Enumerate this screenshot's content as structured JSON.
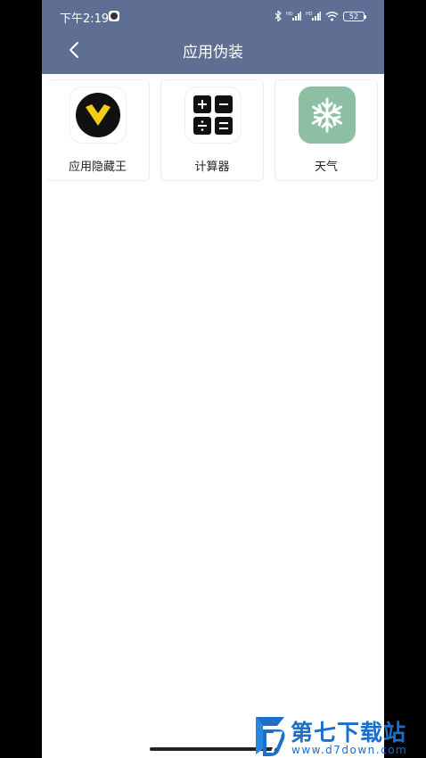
{
  "status_bar": {
    "time": "下午2:19",
    "battery_level": "52",
    "icons": [
      "notification-app-icon",
      "bluetooth-icon",
      "cellular-signal-icon",
      "cellular-signal-icon",
      "wifi-icon",
      "battery-icon"
    ]
  },
  "header": {
    "back_icon": "chevron-left-icon",
    "title": "应用伪装",
    "background_color": "#5f6e93"
  },
  "apps": [
    {
      "label": "应用隐藏王",
      "icon": "app-hider-logo-icon"
    },
    {
      "label": "计算器",
      "icon": "calculator-icon"
    },
    {
      "label": "天气",
      "icon": "snowflake-icon",
      "icon_background": "#8dbfa5"
    }
  ],
  "watermark": {
    "title": "第七下载站",
    "url": "www.d7down.com",
    "color": "#1b6fc9"
  }
}
